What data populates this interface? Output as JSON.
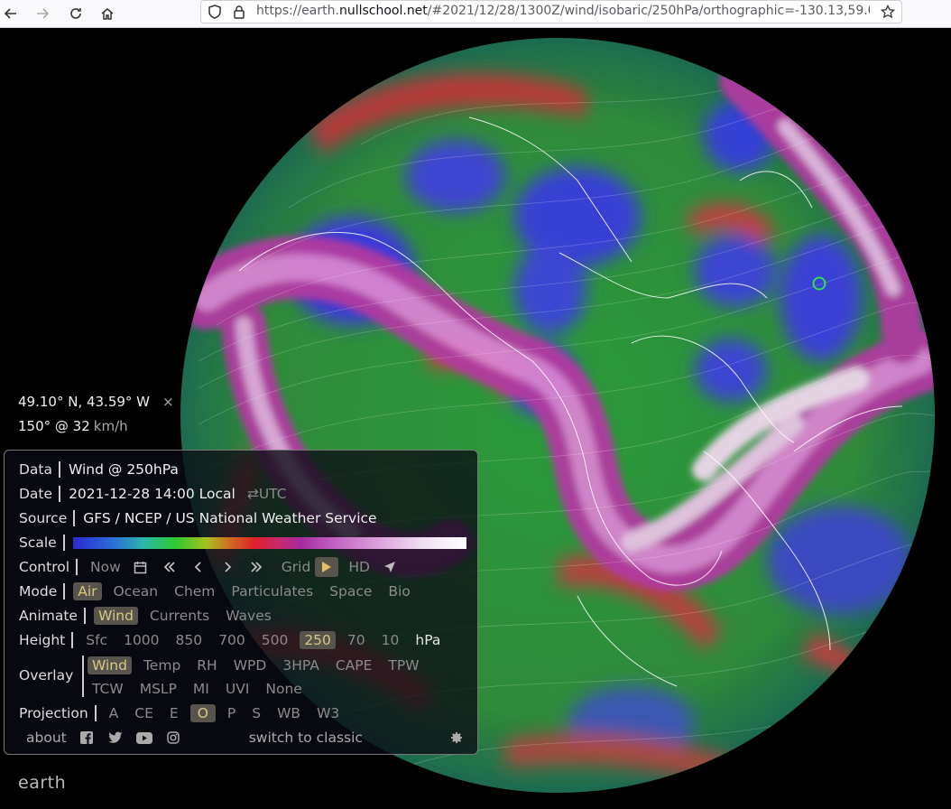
{
  "browser": {
    "url_prefix": "https://earth.",
    "url_domain": "nullschool.net",
    "url_rest": "/#2021/12/28/1300Z/wind/isobaric/250hPa/orthographic=-130.13,59.0"
  },
  "spot": {
    "coords": "49.10° N, 43.59° W",
    "close": "×",
    "wind": "150° @ 32",
    "unit": "km/h"
  },
  "menu": {
    "data": {
      "label": "Data",
      "value": "Wind @ 250hPa"
    },
    "date": {
      "label": "Date",
      "value": "2021-12-28 14:00 Local",
      "utc": "⇄UTC"
    },
    "source": {
      "label": "Source",
      "value": "GFS / NCEP / US National Weather Service"
    },
    "scale": {
      "label": "Scale"
    },
    "control": {
      "label": "Control",
      "now": "Now",
      "grid": "Grid",
      "hd": "HD"
    },
    "mode": {
      "label": "Mode",
      "options": [
        "Air",
        "Ocean",
        "Chem",
        "Particulates",
        "Space",
        "Bio"
      ],
      "selected": "Air"
    },
    "animate": {
      "label": "Animate",
      "options": [
        "Wind",
        "Currents",
        "Waves"
      ],
      "selected": "Wind"
    },
    "height": {
      "label": "Height",
      "options": [
        "Sfc",
        "1000",
        "850",
        "700",
        "500",
        "250",
        "70",
        "10"
      ],
      "selected": "250",
      "unit": "hPa"
    },
    "overlay": {
      "label": "Overlay",
      "row1": [
        "Wind",
        "Temp",
        "RH",
        "WPD",
        "3HPA",
        "CAPE",
        "TPW"
      ],
      "row2": [
        "TCW",
        "MSLP",
        "MI",
        "UVI",
        "None"
      ],
      "selected": "Wind"
    },
    "projection": {
      "label": "Projection",
      "options": [
        "A",
        "CE",
        "E",
        "O",
        "P",
        "S",
        "WB",
        "W3"
      ],
      "selected": "O"
    },
    "footer": {
      "about": "about",
      "classic": "switch to classic"
    }
  },
  "app_label": "earth",
  "colors": {
    "accent": "#d8c882",
    "marker": "#33dd55"
  }
}
